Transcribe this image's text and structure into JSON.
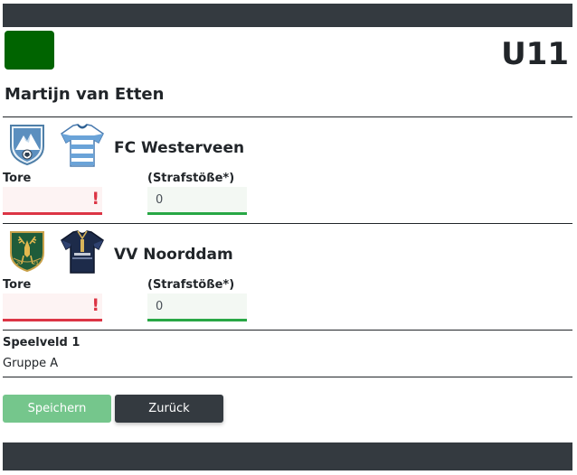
{
  "header": {
    "age_class": "U11",
    "referee_name": "Martijn van Etten"
  },
  "teams": [
    {
      "name": "FC Westerveen",
      "goals_label": "Tore",
      "goals_value": "",
      "goals_error_mark": "!",
      "penalties_label": "(Strafstöße*)",
      "penalties_value": "0"
    },
    {
      "name": "VV Noorddam",
      "goals_label": "Tore",
      "goals_value": "",
      "goals_error_mark": "!",
      "penalties_label": "(Strafstöße*)",
      "penalties_value": "0"
    }
  ],
  "match_info": {
    "field": "Speelveld 1",
    "group": "Gruppe A"
  },
  "buttons": {
    "save_label": "Speichern",
    "back_label": "Zurück"
  },
  "colors": {
    "topbar": "#343a40",
    "logo": "#006400",
    "invalid": "#dc3545",
    "valid": "#28a745",
    "save_button": "#75c68c",
    "back_button": "#343a40"
  }
}
